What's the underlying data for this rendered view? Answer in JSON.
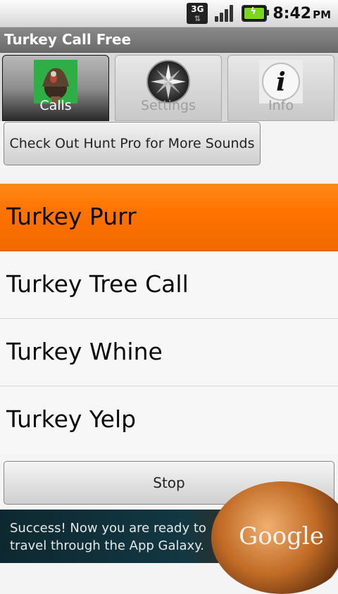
{
  "status_bar": {
    "network": "3G",
    "time": "8:42",
    "ampm": "PM"
  },
  "app": {
    "title": "Turkey Call Free"
  },
  "tabs": [
    {
      "label": "Calls",
      "icon": "turkey-icon",
      "active": true
    },
    {
      "label": "Settings",
      "icon": "compass-icon",
      "active": false
    },
    {
      "label": "Info",
      "icon": "info-icon",
      "active": false
    }
  ],
  "promo_button": "Check Out Hunt Pro for More Sounds",
  "calls": [
    {
      "label": "Turkey Purr",
      "selected": true
    },
    {
      "label": "Turkey Tree Call",
      "selected": false
    },
    {
      "label": "Turkey Whine",
      "selected": false
    },
    {
      "label": "Turkey Yelp",
      "selected": false
    }
  ],
  "stop_button": "Stop",
  "ad": {
    "line1": "Success! Now you are ready to",
    "line2": "travel through the App Galaxy.",
    "brand": "Google"
  },
  "colors": {
    "selected": "#ff7a00",
    "title_bar": "#7a7a7a"
  }
}
